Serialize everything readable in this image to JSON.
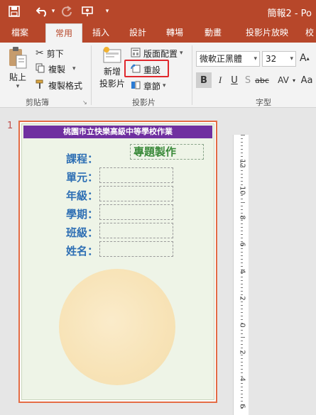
{
  "titlebar": {
    "title": "簡報2 - Po",
    "quick_access": [
      {
        "name": "save-icon",
        "glyph": "💾"
      },
      {
        "name": "undo-icon",
        "glyph": "↶"
      },
      {
        "name": "undo-dropdown-icon",
        "glyph": "▾"
      },
      {
        "name": "redo-icon",
        "glyph": "↻"
      },
      {
        "name": "present-icon",
        "glyph": "⎚"
      },
      {
        "name": "customize-dropdown-icon",
        "glyph": "▾"
      }
    ]
  },
  "tabs": [
    "檔案",
    "常用",
    "插入",
    "設計",
    "轉場",
    "動畫",
    "投影片放映",
    "校"
  ],
  "active_tab": "常用",
  "clipboard": {
    "paste": "貼上",
    "cut": "剪下",
    "copy": "複製",
    "format_painter": "複製格式",
    "group_label": "剪貼簿"
  },
  "slides_group": {
    "new_slide_line1": "新增",
    "new_slide_line2": "投影片",
    "layout": "版面配置",
    "reset": "重設",
    "section": "章節",
    "group_label": "投影片"
  },
  "font_group": {
    "font_name": "微軟正黑體",
    "font_size": "32",
    "bold": "B",
    "italic": "I",
    "underline": "U",
    "strike": "S",
    "shadow": "abc",
    "spacing": "AV",
    "case": "Aa",
    "group_label": "字型"
  },
  "slide": {
    "number": "1",
    "header": "桃園市立快樂高級中等學校作業",
    "topic_label": "課程：",
    "topic_value": "專題製作",
    "fields": [
      "單元：",
      "年級：",
      "學期：",
      "班級：",
      "姓名："
    ]
  },
  "ruler": {
    "labels": [
      "12",
      "10",
      "8",
      "6",
      "4",
      "2",
      "0",
      "2",
      "4",
      "6"
    ]
  },
  "colors": {
    "accent": "#b7472a",
    "header_bar": "#7030a0",
    "label_blue": "#2e6fb4",
    "highlight_box": "#e0282d",
    "slide_border": "#e46c45"
  }
}
